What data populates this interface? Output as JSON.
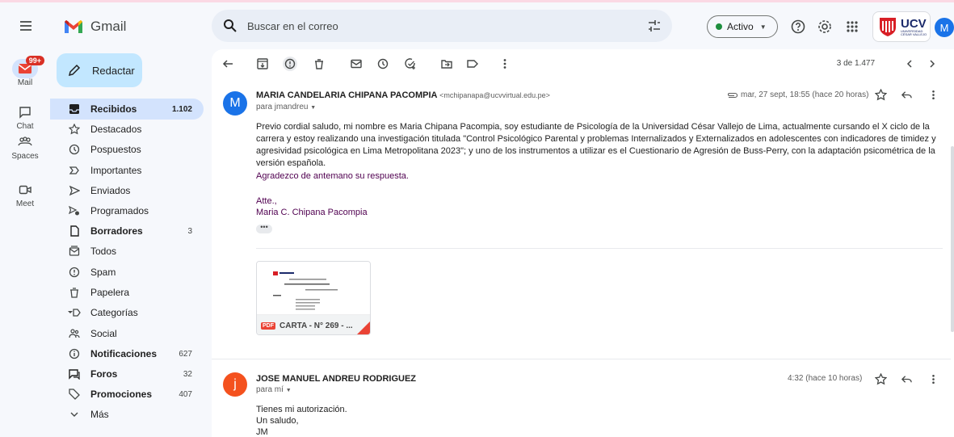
{
  "app": {
    "name": "Gmail"
  },
  "search": {
    "placeholder": "Buscar en el correo"
  },
  "status": {
    "label": "Activo",
    "color": "#1e8e3e"
  },
  "org_logo": {
    "text": "UCV",
    "subtext": "UNIVERSIDAD CÉSAR VALLEJO"
  },
  "account": {
    "initial": "M",
    "color": "#1a73e8"
  },
  "rail": {
    "mail": {
      "label": "Mail",
      "badge": "99+"
    },
    "chat": {
      "label": "Chat"
    },
    "spaces": {
      "label": "Spaces"
    },
    "meet": {
      "label": "Meet"
    }
  },
  "compose": {
    "label": "Redactar"
  },
  "nav": {
    "inbox": {
      "label": "Recibidos",
      "count": "1.102"
    },
    "starred": {
      "label": "Destacados"
    },
    "snoozed": {
      "label": "Pospuestos"
    },
    "important": {
      "label": "Importantes"
    },
    "sent": {
      "label": "Enviados"
    },
    "scheduled": {
      "label": "Programados"
    },
    "drafts": {
      "label": "Borradores",
      "count": "3"
    },
    "all": {
      "label": "Todos"
    },
    "spam": {
      "label": "Spam"
    },
    "trash": {
      "label": "Papelera"
    },
    "categories": {
      "label": "Categorías"
    },
    "social": {
      "label": "Social"
    },
    "updates": {
      "label": "Notificaciones",
      "count": "627"
    },
    "forums": {
      "label": "Foros",
      "count": "32"
    },
    "promotions": {
      "label": "Promociones",
      "count": "407"
    },
    "more": {
      "label": "Más"
    }
  },
  "thread": {
    "position": "3 de 1.477"
  },
  "messages": [
    {
      "initial": "M",
      "avatar_color": "#1a73e8",
      "sender": "MARIA CANDELARIA CHIPANA PACOMPIA",
      "email": "<mchipanapa@ucvvirtual.edu.pe>",
      "to": "para jmandreu",
      "date": "mar, 27 sept, 18:55 (hace 20 horas)",
      "body1": "Previo cordial saludo, mi nombre es Maria Chipana Pacompia, soy estudiante de Psicología de la Universidad César Vallejo de Lima, actualmente cursando el X ciclo de la carrera y estoy realizando una investigación titulada \"Control Psicológico Parental y problemas Internalizados y Externalizados en adolescentes con indicadores de timidez y agresividad psicológica en Lima Metropolitana 2023\"; y uno de los instrumentos a utilizar es el Cuestionario de Agresión de Buss-Perry, con la adaptación psicométrica de la versión española.",
      "body2": "Agradezco de antemano su respuesta.",
      "sign1": "Atte.,",
      "sign2": "Maria C. Chipana Pacompia",
      "attachment": {
        "type": "PDF",
        "name": "CARTA - N° 269 - ..."
      }
    },
    {
      "initial": "j",
      "avatar_color": "#f4511e",
      "sender": "JOSE MANUEL ANDREU RODRIGUEZ",
      "to": "para mí",
      "date": "4:32 (hace 10 horas)",
      "line1": "Tienes mi autorización.",
      "line2": "Un saludo,",
      "line3": "JM"
    }
  ]
}
